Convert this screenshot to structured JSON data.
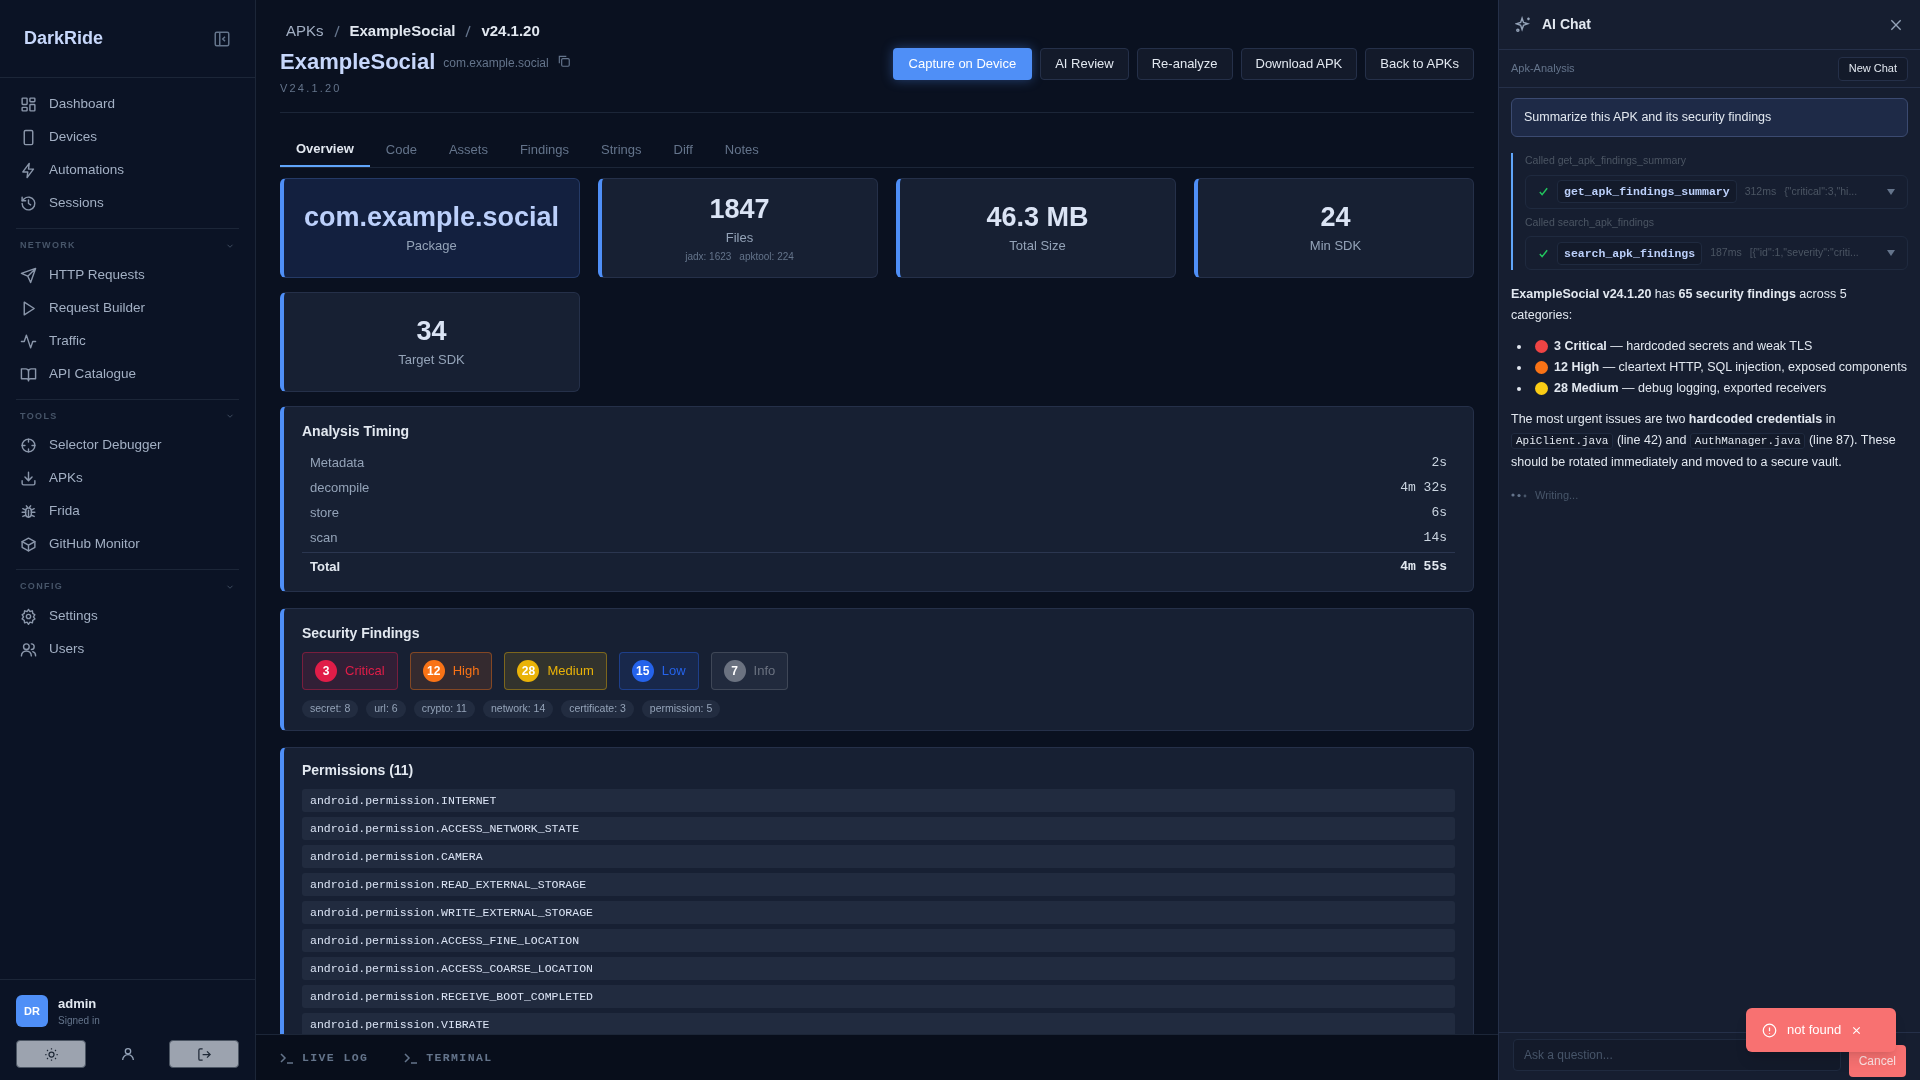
{
  "sidebar": {
    "brand": "DarkRide",
    "sections": [
      {
        "items": [
          {
            "label": "Dashboard"
          },
          {
            "label": "Devices"
          },
          {
            "label": "Automations"
          },
          {
            "label": "Sessions"
          }
        ]
      },
      {
        "label": "NETWORK",
        "expanded": true,
        "items": [
          {
            "label": "HTTP Requests"
          },
          {
            "label": "Request Builder"
          },
          {
            "label": "Traffic"
          },
          {
            "label": "API Catalogue"
          }
        ]
      },
      {
        "label": "TOOLS",
        "expanded": true,
        "items": [
          {
            "label": "Selector Debugger"
          },
          {
            "label": "APKs"
          },
          {
            "label": "Frida"
          },
          {
            "label": "GitHub Monitor"
          }
        ]
      },
      {
        "label": "CONFIG",
        "expanded": true,
        "items": [
          {
            "label": "Settings"
          },
          {
            "label": "Users"
          }
        ]
      }
    ],
    "user": {
      "initials": "DR",
      "name": "admin",
      "status": "Signed in"
    }
  },
  "breadcrumb": [
    "APKs",
    "ExampleSocial",
    "v24.1.20"
  ],
  "title": "ExampleSocial",
  "package": "com.example.social",
  "version": "V24.1.20",
  "actions": [
    {
      "label": "Capture on Device",
      "primary": true
    },
    {
      "label": "AI Review",
      "primary": false
    },
    {
      "label": "Re-analyze",
      "primary": false
    },
    {
      "label": "Download APK",
      "primary": false
    },
    {
      "label": "Back to APKs",
      "primary": false
    }
  ],
  "tabs": [
    {
      "label": "Overview",
      "selected": true
    },
    {
      "label": "Code",
      "selected": false
    },
    {
      "label": "Assets",
      "selected": false
    },
    {
      "label": "Findings",
      "selected": false
    },
    {
      "label": "Strings",
      "selected": false
    },
    {
      "label": "Diff",
      "selected": false
    },
    {
      "label": "Notes",
      "selected": false
    }
  ],
  "stats": [
    {
      "value": "com.example.social",
      "label": "Package",
      "highlighted": true
    },
    {
      "value": "1847",
      "label": "Files",
      "highlighted": false,
      "sub": [
        "jadx: 1623",
        "apktool: 224"
      ]
    },
    {
      "value": "46.3 MB",
      "label": "Total Size",
      "highlighted": false
    },
    {
      "value": "24",
      "label": "Min SDK",
      "highlighted": false
    },
    {
      "value": "34",
      "label": "Target SDK",
      "highlighted": false
    }
  ],
  "timing": {
    "title": "Analysis Timing",
    "rows": [
      {
        "kind": "step",
        "label": "Metadata",
        "value": "2s"
      },
      {
        "kind": "step",
        "label": "decompile",
        "value": "4m 32s"
      },
      {
        "kind": "step",
        "label": "store",
        "value": "6s"
      },
      {
        "kind": "step",
        "label": "scan",
        "value": "14s"
      },
      {
        "kind": "total",
        "label": "Total",
        "value": "4m 55s"
      }
    ]
  },
  "findings": {
    "title": "Security Findings",
    "severities": [
      {
        "count": "3",
        "label": "Critical",
        "color": "#e11d48"
      },
      {
        "count": "12",
        "label": "High",
        "color": "#f97316"
      },
      {
        "count": "28",
        "label": "Medium",
        "color": "#eab308"
      },
      {
        "count": "15",
        "label": "Low",
        "color": "#2563eb"
      },
      {
        "count": "7",
        "label": "Info",
        "color": "#6b7280"
      }
    ],
    "tags": [
      "secret: 8",
      "url: 6",
      "crypto: 11",
      "network: 14",
      "certificate: 3",
      "permission: 5"
    ]
  },
  "permissions": {
    "title": "Permissions (11)",
    "items": [
      "android.permission.INTERNET",
      "android.permission.ACCESS_NETWORK_STATE",
      "android.permission.CAMERA",
      "android.permission.READ_EXTERNAL_STORAGE",
      "android.permission.WRITE_EXTERNAL_STORAGE",
      "android.permission.ACCESS_FINE_LOCATION",
      "android.permission.ACCESS_COARSE_LOCATION",
      "android.permission.RECEIVE_BOOT_COMPLETED",
      "android.permission.VIBRATE"
    ]
  },
  "bottom_tabs": [
    "LIVE LOG",
    "TERMINAL"
  ],
  "chat": {
    "title": "AI Chat",
    "context": "Apk-Analysis",
    "new_chat": "New Chat",
    "user_message": "Summarize this APK and its security findings",
    "tool_calls": [
      {
        "called": "Called get_apk_findings_summary",
        "name": "get_apk_findings_summary",
        "duration": "312ms",
        "preview": "{\"critical\":3,\"hi...",
        "ok": true
      },
      {
        "called": "Called search_apk_findings",
        "name": "search_apk_findings",
        "duration": "187ms",
        "preview": "[{\"id\":1,\"severity\":\"criti...",
        "ok": true
      }
    ],
    "answer": [
      {
        "kind": "paragraph",
        "parts": [
          {
            "kind": "text",
            "text": "**ExampleSocial v24.1.20** has **65 security findings** across 5 categories:"
          }
        ]
      },
      {
        "kind": "list",
        "items": [
          {
            "color": "#ef4444",
            "text": "**3 Critical** — hardcoded secrets and weak TLS"
          },
          {
            "color": "#f97316",
            "text": "**12 High** — cleartext HTTP, SQL injection, exposed components"
          },
          {
            "color": "#facc15",
            "text": "**28 Medium** — debug logging, exported receivers"
          }
        ]
      },
      {
        "kind": "paragraph",
        "parts": [
          {
            "kind": "text",
            "text": "The most urgent issues are two **hardcoded credentials** in "
          },
          {
            "kind": "code",
            "text": "ApiClient.java"
          },
          {
            "kind": "text",
            "text": " (line 42) and "
          },
          {
            "kind": "code",
            "text": "AuthManager.java"
          },
          {
            "kind": "text",
            "text": " (line 87). These should be rotated immediately and moved to a secure vault."
          }
        ]
      }
    ],
    "status": "Writing...",
    "input_placeholder": "Ask a question...",
    "cancel": "Cancel",
    "toast": "not found"
  }
}
